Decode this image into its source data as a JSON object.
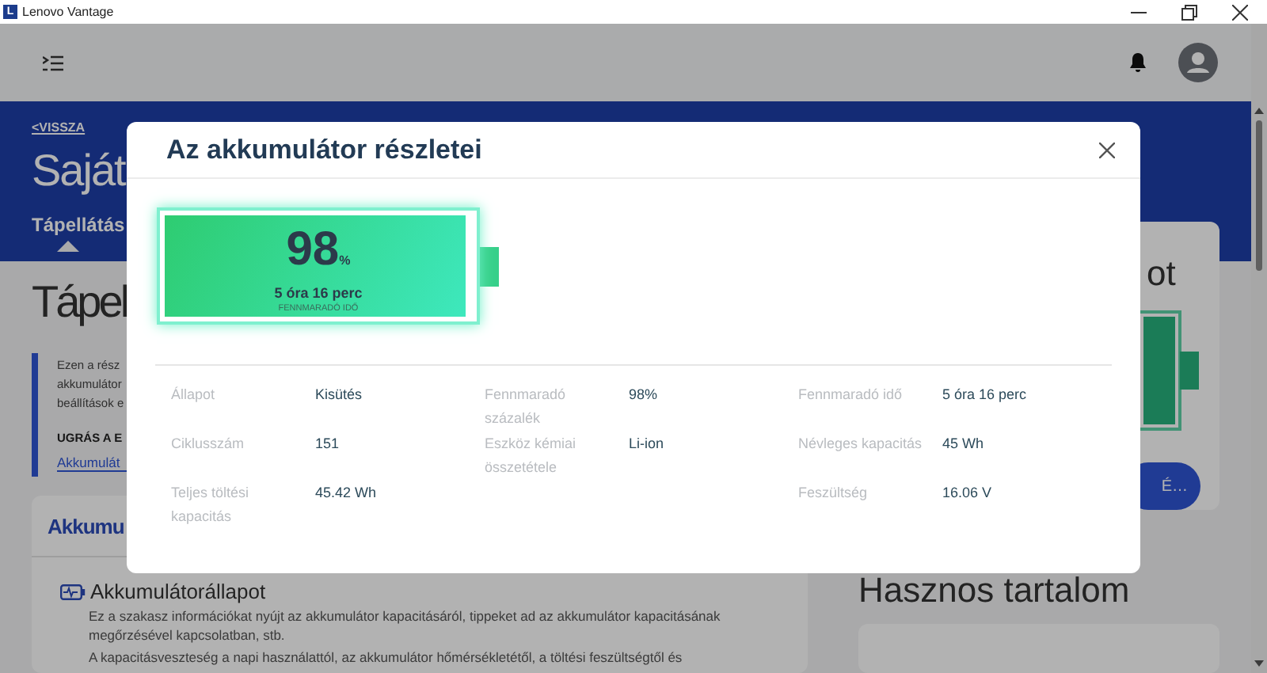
{
  "window": {
    "app_name": "Lenovo Vantage",
    "logo": "L"
  },
  "page": {
    "back_link": "<VISSZA",
    "title": "Saját",
    "tabs": [
      {
        "label": "Tápellátás",
        "selected": true
      }
    ],
    "section_title": "Tápel",
    "intro_lines": [
      "Ezen a rész",
      "akkumulátor",
      "beállítások e"
    ],
    "jump_heading": "UGRÁS A E",
    "jump_link": "Akkumulát"
  },
  "battery_card": {
    "title": "Akkumu",
    "item_title": "Akkumulátorállapot",
    "paragraphs": [
      "Ez a szakasz információkat nyújt az akkumulátor kapacitásáról, tippeket ad az akkumulátor kapacitásának megőrzésével kapcsolatban, stb.",
      "A kapacitásveszteség a napi használattól, az akkumulátor hőmérsékletétől, a töltési feszültségtől és"
    ]
  },
  "side_card": {
    "title": "ot",
    "button": "É…"
  },
  "useful": {
    "title": "Hasznos tartalom"
  },
  "dialog": {
    "title": "Az akkumulátor részletei",
    "battery": {
      "percent": "98",
      "unit": "%",
      "time": "5 óra 16 perc",
      "caption": "FENNMARADÓ IDŐ",
      "level": 0.98
    },
    "columns": [
      [
        {
          "label": "Állapot",
          "value": "Kisütés"
        },
        {
          "label": "Ciklusszám",
          "value": "151"
        },
        {
          "label": "Teljes töltési kapacitás",
          "value": "45.42 Wh"
        }
      ],
      [
        {
          "label": "Fennmaradó százalék",
          "value": "98%"
        },
        {
          "label": "Eszköz kémiai összetétele",
          "value": "Li-ion"
        }
      ],
      [
        {
          "label": "Fennmaradó idő",
          "value": "5 óra 16 perc"
        },
        {
          "label": "Névleges kapacitás",
          "value": "45 Wh"
        },
        {
          "label": "Feszültség",
          "value": "16.06 V"
        }
      ]
    ]
  }
}
